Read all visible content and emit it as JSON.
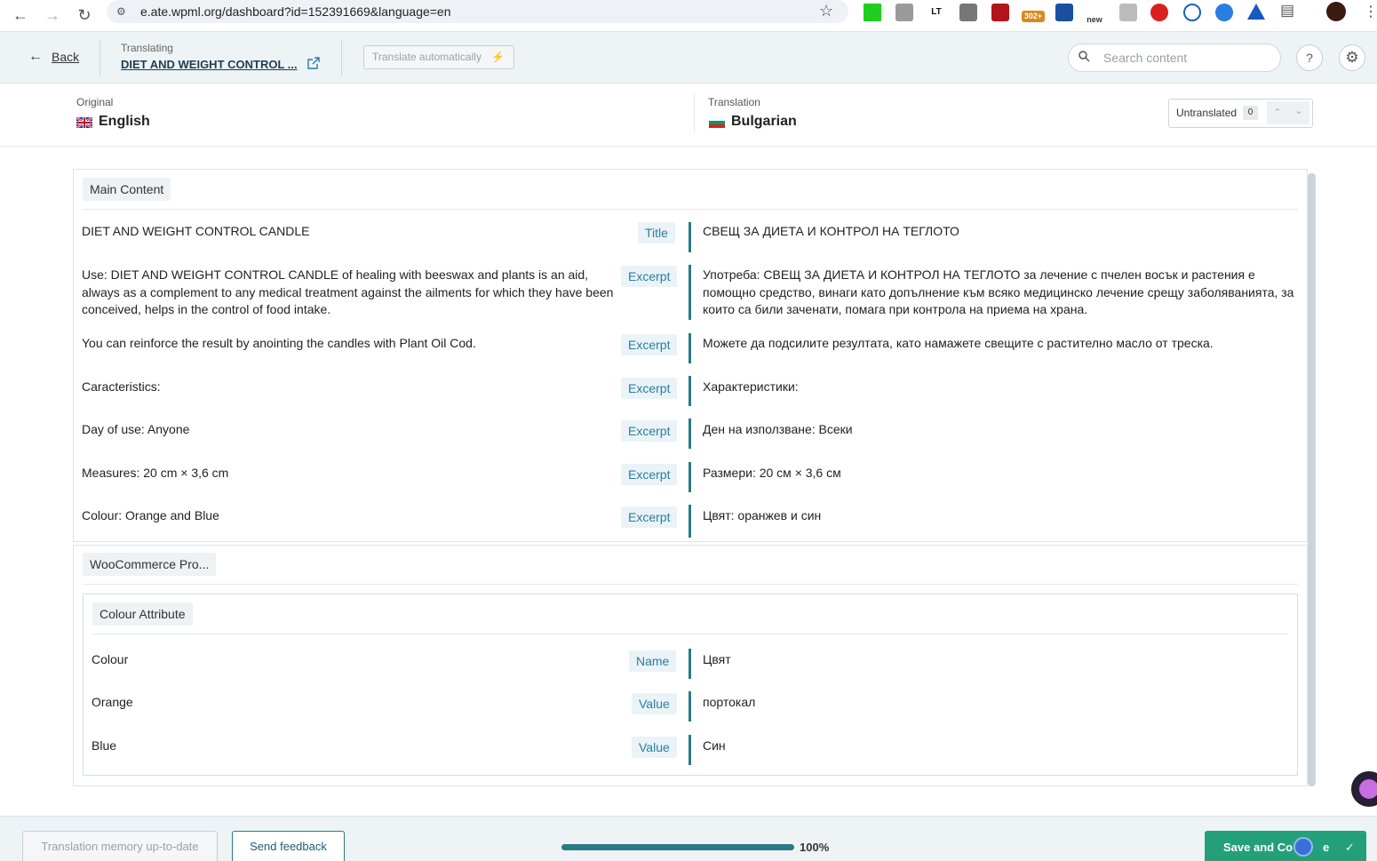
{
  "browser": {
    "url": "e.ate.wpml.org/dashboard?id=152391669&language=en",
    "extension_badges": {
      "count": "302+",
      "new": "new",
      "lt": "LT"
    }
  },
  "header": {
    "back_label": "Back",
    "translating_label": "Translating",
    "doc_title": "DIET AND WEIGHT CONTROL ...",
    "translate_auto_label": "Translate automatically",
    "search_placeholder": "Search content"
  },
  "languages": {
    "original_label": "Original",
    "original_name": "English",
    "translation_label": "Translation",
    "translation_name": "Bulgarian",
    "untranslated_label": "Untranslated",
    "untranslated_count": "0"
  },
  "main_content": {
    "chip": "Main Content",
    "rows": [
      {
        "source": "DIET AND WEIGHT CONTROL CANDLE",
        "tag": "Title",
        "target": "СВЕЩ ЗА ДИЕТА И КОНТРОЛ НА ТЕГЛОТО"
      },
      {
        "source": "Use: DIET AND WEIGHT CONTROL CANDLE of healing with beeswax and plants is an aid, always as a complement to any medical treatment against the ailments for which they have been conceived, helps in the control of food intake.",
        "tag": "Excerpt",
        "target": "Употреба: СВЕЩ ЗА ДИЕТА И КОНТРОЛ НА ТЕГЛОТО за лечение с пчелен восък и растения е помощно средство, винаги като допълнение към всяко медицинско лечение срещу заболяванията, за които са били заченати, помага при контрола на приема на храна."
      },
      {
        "source": "You can reinforce the result by anointing the candles with Plant Oil Cod.",
        "tag": "Excerpt",
        "target": "Можете да подсилите резултата, като намажете свещите с растително масло от треска."
      },
      {
        "source": "Caracteristics:",
        "tag": "Excerpt",
        "target": "Характеристики:"
      },
      {
        "source": "Day of use: Anyone",
        "tag": "Excerpt",
        "target": "Ден на използване: Всеки"
      },
      {
        "source": "Measures: 20 cm × 3,6 cm",
        "tag": "Excerpt",
        "target": "Размери: 20 см × 3,6 см"
      },
      {
        "source": "Colour: Orange and Blue",
        "tag": "Excerpt",
        "target": "Цвят: оранжев и син"
      }
    ]
  },
  "woocommerce": {
    "chip": "WooCommerce Pro...",
    "sub_chip": "Colour Attribute",
    "rows": [
      {
        "source": "Colour",
        "tag": "Name",
        "target": "Цвят"
      },
      {
        "source": "Orange",
        "tag": "Value",
        "target": "портокал"
      },
      {
        "source": "Blue",
        "tag": "Value",
        "target": "Син"
      }
    ]
  },
  "footer": {
    "memory_label": "Translation memory up-to-date",
    "feedback_label": "Send feedback",
    "progress": 1.0,
    "progress_label": "100%",
    "save_label": "Save and Co",
    "save_label_tail": "e"
  },
  "colors": {
    "accent": "#2b7a85",
    "save": "#23a07a",
    "tag_text": "#2a7da3"
  },
  "icons": [
    "arrow-left-icon",
    "arrow-right-icon",
    "reload-icon",
    "site-info-icon",
    "star-icon",
    "external-link-icon",
    "lightning-icon",
    "search-icon",
    "help-icon",
    "gear-icon",
    "chevron-up-icon",
    "chevron-down-icon",
    "check-icon",
    "uk-flag-icon",
    "bg-flag-icon"
  ]
}
